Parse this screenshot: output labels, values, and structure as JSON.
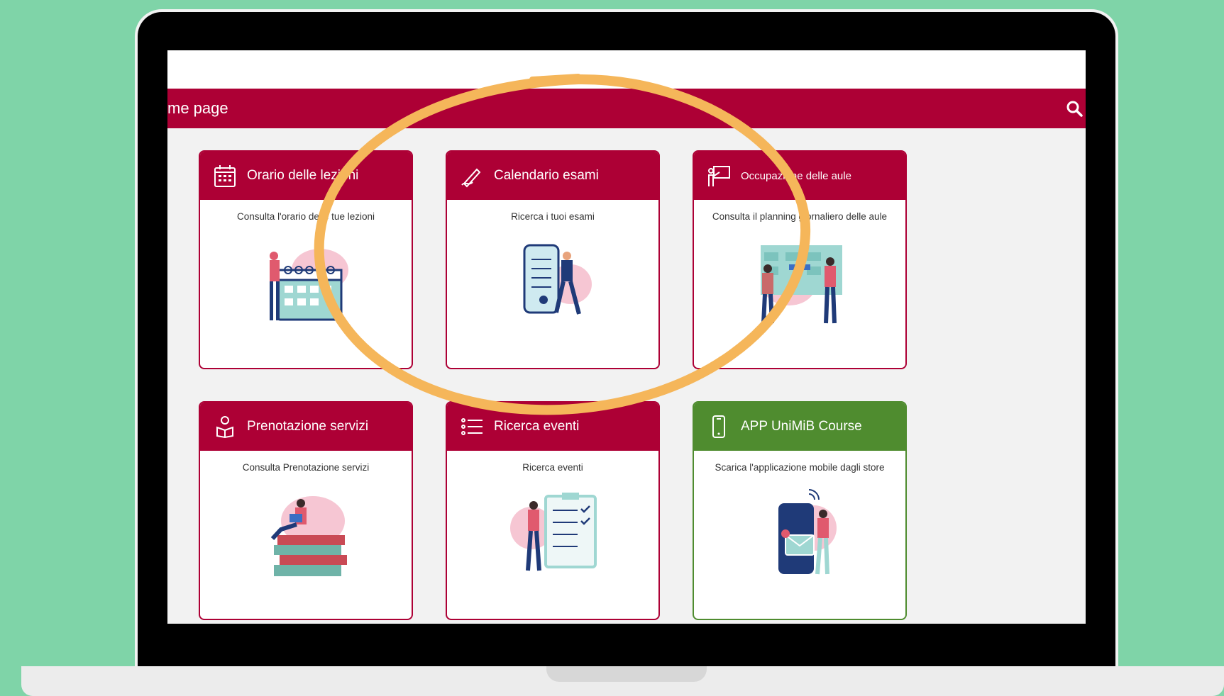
{
  "navbar": {
    "title": "me page"
  },
  "cards": [
    {
      "title": "Orario delle lezioni",
      "description": "Consulta l'orario delle tue lezioni"
    },
    {
      "title": "Calendario esami",
      "description": "Ricerca i tuoi esami"
    },
    {
      "title": "Occupazione delle aule",
      "description": "Consulta il planning giornaliero delle aule"
    },
    {
      "title": "Prenotazione servizi",
      "description": "Consulta Prenotazione servizi"
    },
    {
      "title": "Ricerca eventi",
      "description": "Ricerca eventi"
    },
    {
      "title": "APP UniMiB Course",
      "description": "Scarica l'applicazione mobile dagli store"
    }
  ],
  "colors": {
    "brand": "#ad0035",
    "app_green": "#4f8c2f",
    "background": "#7fd4a8",
    "highlight": "#f5b65a"
  }
}
